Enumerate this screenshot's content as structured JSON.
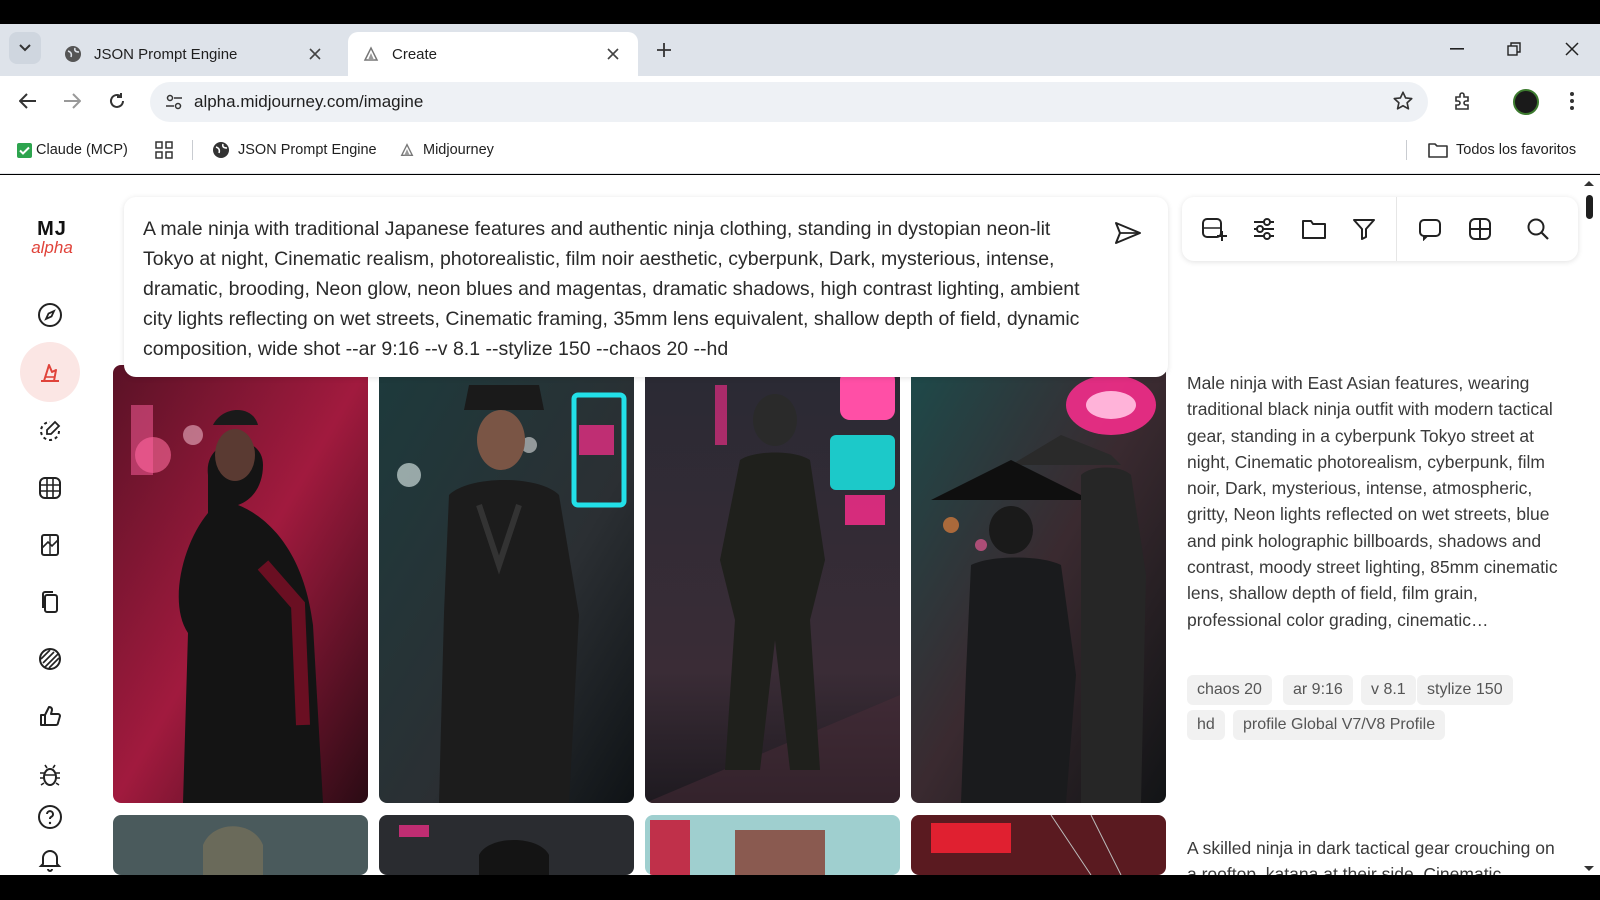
{
  "browser": {
    "tabs": [
      {
        "title": "JSON Prompt Engine",
        "active": false
      },
      {
        "title": "Create",
        "active": true
      }
    ],
    "url": "alpha.midjourney.com/imagine",
    "bookmarks": [
      "Claude (MCP)",
      "JSON Prompt Engine",
      "Midjourney"
    ],
    "all_bookmarks": "Todos los favoritos"
  },
  "sidebar": {
    "logo_top": "MJ",
    "logo_bottom": "alpha",
    "items": [
      "explore-icon",
      "create-icon",
      "edit-icon",
      "organize-icon",
      "personalize-icon",
      "moodboard-icon",
      "draft-icon",
      "rate-icon",
      "bug-icon",
      "help-icon",
      "bell-icon"
    ]
  },
  "prompt": {
    "text": "A male ninja with traditional Japanese features and authentic ninja clothing, standing in dystopian neon-lit Tokyo at night, Cinematic realism, photorealistic, film noir aesthetic, cyberpunk, Dark, mysterious, intense, dramatic, brooding, Neon glow, neon blues and magentas, dramatic shadows, high contrast lighting, ambient city lights reflecting on wet streets, Cinematic framing, 35mm lens equivalent, shallow depth of field, dynamic composition, wide shot --ar 9:16 --v 8.1 --stylize 150 --chaos 20 --hd"
  },
  "details": {
    "description": "Male ninja with East Asian features, wearing traditional black ninja outfit with modern tactical gear, standing in a cyberpunk Tokyo street at night, Cinematic photorealism, cyberpunk, film noir, Dark, mysterious, intense, atmospheric, gritty, Neon lights reflected on wet streets, blue and pink holographic billboards, shadows and contrast, moody street lighting, 85mm cinematic lens, shallow depth of field, film grain, professional color grading, cinematic…",
    "chips": [
      "chaos 20",
      "ar 9:16",
      "v 8.1",
      "stylize 150",
      "hd",
      "profile Global V7/V8 Profile"
    ],
    "next_description": "A skilled ninja in dark tactical gear crouching on a rooftop, katana at their side, Cinematic"
  },
  "colors": {
    "accent": "#e0433a",
    "accent_bg": "#fbe6e4",
    "neon_pink": "#ff2d8f",
    "neon_cyan": "#22e0e8"
  }
}
